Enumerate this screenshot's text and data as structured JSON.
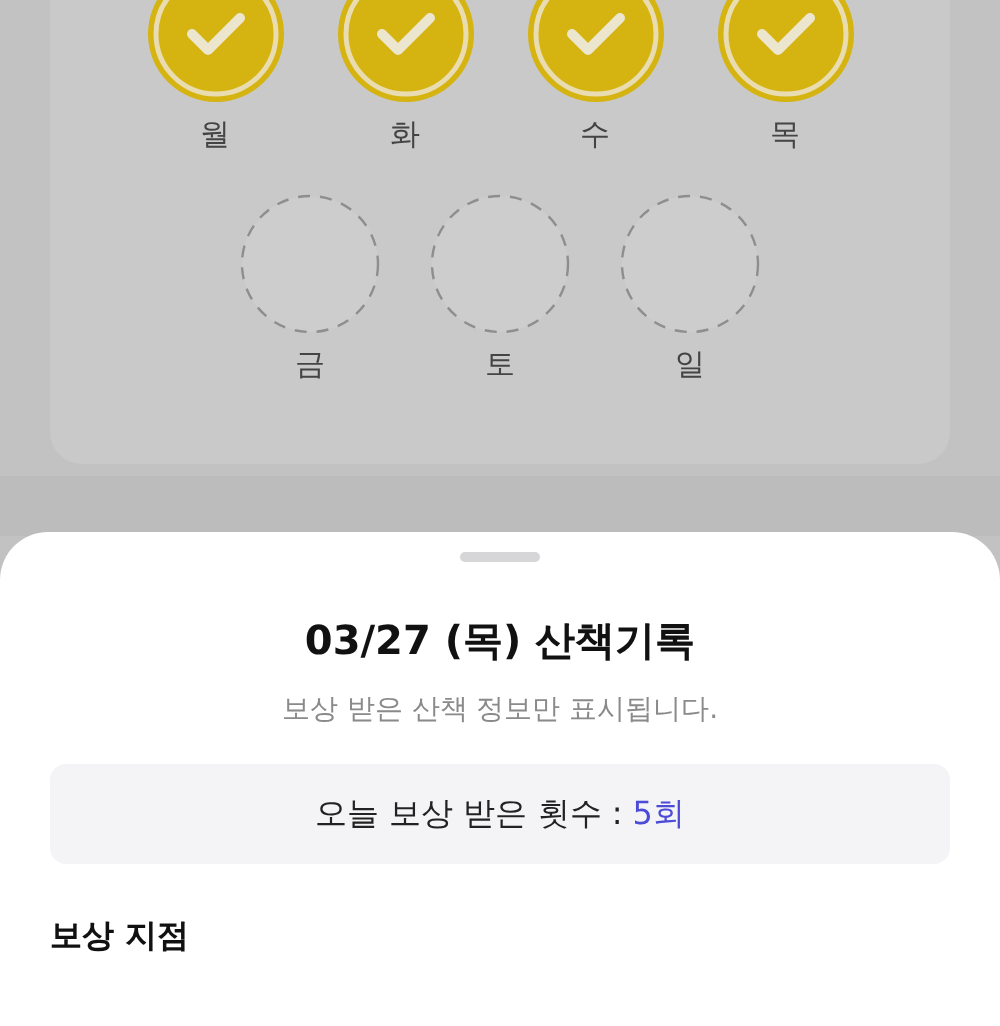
{
  "week_days": [
    {
      "label": "월",
      "checked": true
    },
    {
      "label": "화",
      "checked": true
    },
    {
      "label": "수",
      "checked": true
    },
    {
      "label": "목",
      "checked": true
    },
    {
      "label": "금",
      "checked": false
    },
    {
      "label": "토",
      "checked": false
    },
    {
      "label": "일",
      "checked": false
    }
  ],
  "sheet": {
    "title": "03/27 (목) 산책기록",
    "subtitle": "보상 받은 산책 정보만 표시됩니다.",
    "reward_count": {
      "label": "오늘 보상 받은 횟수 :",
      "value": "5회"
    },
    "section_title": "보상 지점"
  }
}
